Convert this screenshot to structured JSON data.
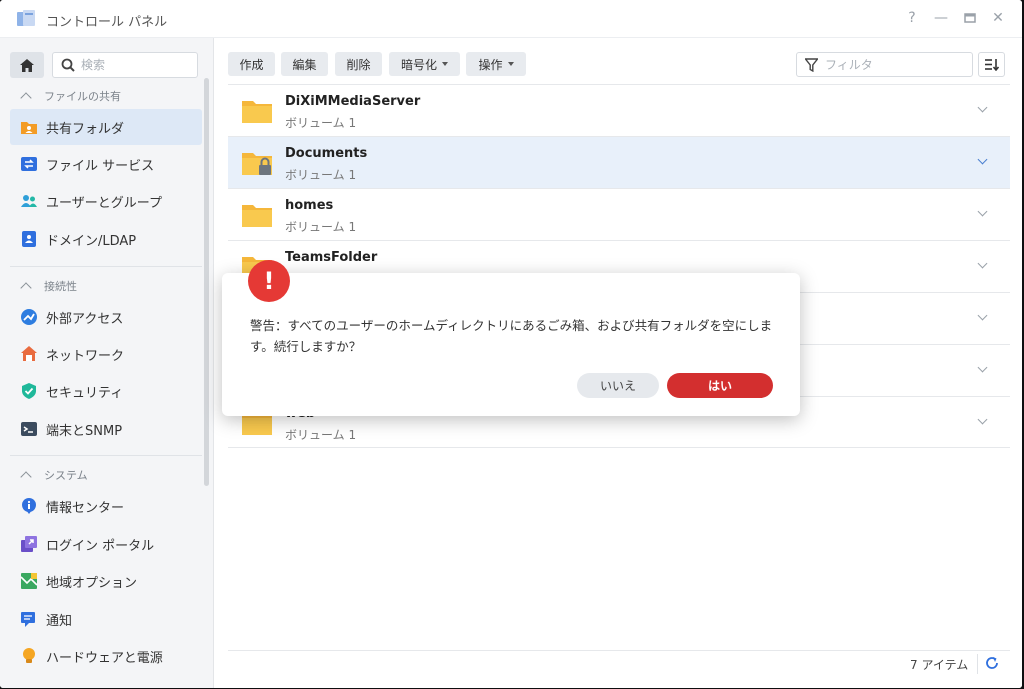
{
  "window": {
    "title": "コントロール パネル"
  },
  "sidebar": {
    "search_placeholder": "検索",
    "sections": [
      {
        "header": "ファイルの共有",
        "items": [
          "共有フォルダ",
          "ファイル サービス",
          "ユーザーとグループ",
          "ドメイン/LDAP"
        ]
      },
      {
        "header": "接続性",
        "items": [
          "外部アクセス",
          "ネットワーク",
          "セキュリティ",
          "端末とSNMP"
        ]
      },
      {
        "header": "システム",
        "items": [
          "情報センター",
          "ログイン ポータル",
          "地域オプション",
          "通知",
          "ハードウェアと電源"
        ]
      }
    ]
  },
  "toolbar": {
    "create": "作成",
    "edit": "編集",
    "delete": "削除",
    "encrypt": "暗号化",
    "action": "操作",
    "filter_placeholder": "フィルタ"
  },
  "folders": [
    {
      "name": "DiXiMMediaServer",
      "sub": "ボリューム 1"
    },
    {
      "name": "Documents",
      "sub": "ボリューム 1"
    },
    {
      "name": "homes",
      "sub": "ボリューム 1"
    },
    {
      "name": "TeamsFolder",
      "sub": ""
    },
    {
      "name": "",
      "sub": ""
    },
    {
      "name": "",
      "sub": ""
    },
    {
      "name": "web",
      "sub": "ボリューム 1"
    }
  ],
  "footer": {
    "count": "7 アイテム"
  },
  "dialog": {
    "icon_glyph": "!",
    "message": "警告：すべてのユーザーのホームディレクトリにあるごみ箱、および共有フォルダを空にします。続行しますか？",
    "no": "いいえ",
    "yes": "はい"
  },
  "colors": {
    "accent": "#2f6fde",
    "danger": "#d32f2f",
    "folder": "#f7c446"
  }
}
